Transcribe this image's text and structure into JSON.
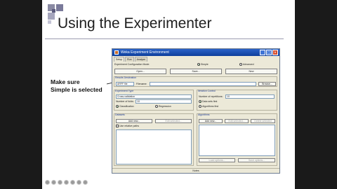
{
  "slide": {
    "title": "Using the Experimenter",
    "callout_line1": "Make sure",
    "callout_line2": "Simple is selected"
  },
  "weka": {
    "window_title": "Weka Experiment Environment",
    "tabs": [
      "Setup",
      "Run",
      "Analyse"
    ],
    "config_mode_label": "Experiment Configuration Mode:",
    "mode_simple": "Simple",
    "mode_advanced": "Advanced",
    "btn_open": "Open...",
    "btn_save": "Save...",
    "btn_new": "New",
    "results_destination": "Results Destination",
    "dest_select": "ARFF file",
    "filename_label": "Filename:",
    "browse": "Browse...",
    "experiment_type": "Experiment Type",
    "exp_type_value": "Cross-validation",
    "folds_label": "Number of folds:",
    "folds_value": "10",
    "classification": "Classification",
    "regression": "Regression",
    "iteration_control": "Iteration Control",
    "repetitions_label": "Number of repetitions:",
    "repetitions_value": "10",
    "data_first": "Data sets first",
    "algorithms_first": "Algorithms first",
    "datasets": "Datasets",
    "add_new": "Add new...",
    "edit_selected": "Edit selected...",
    "delete_selected": "Delete selected",
    "use_relative": "Use relative paths",
    "algorithms": "Algorithms",
    "load_options": "Load options...",
    "save_options": "Save options...",
    "notes": "Notes",
    "up": "Up",
    "down": "Down"
  },
  "colors": {
    "titlebar": "#0e3f9c",
    "group_label": "#1f3c93",
    "window_bg": "#ece9d8"
  }
}
